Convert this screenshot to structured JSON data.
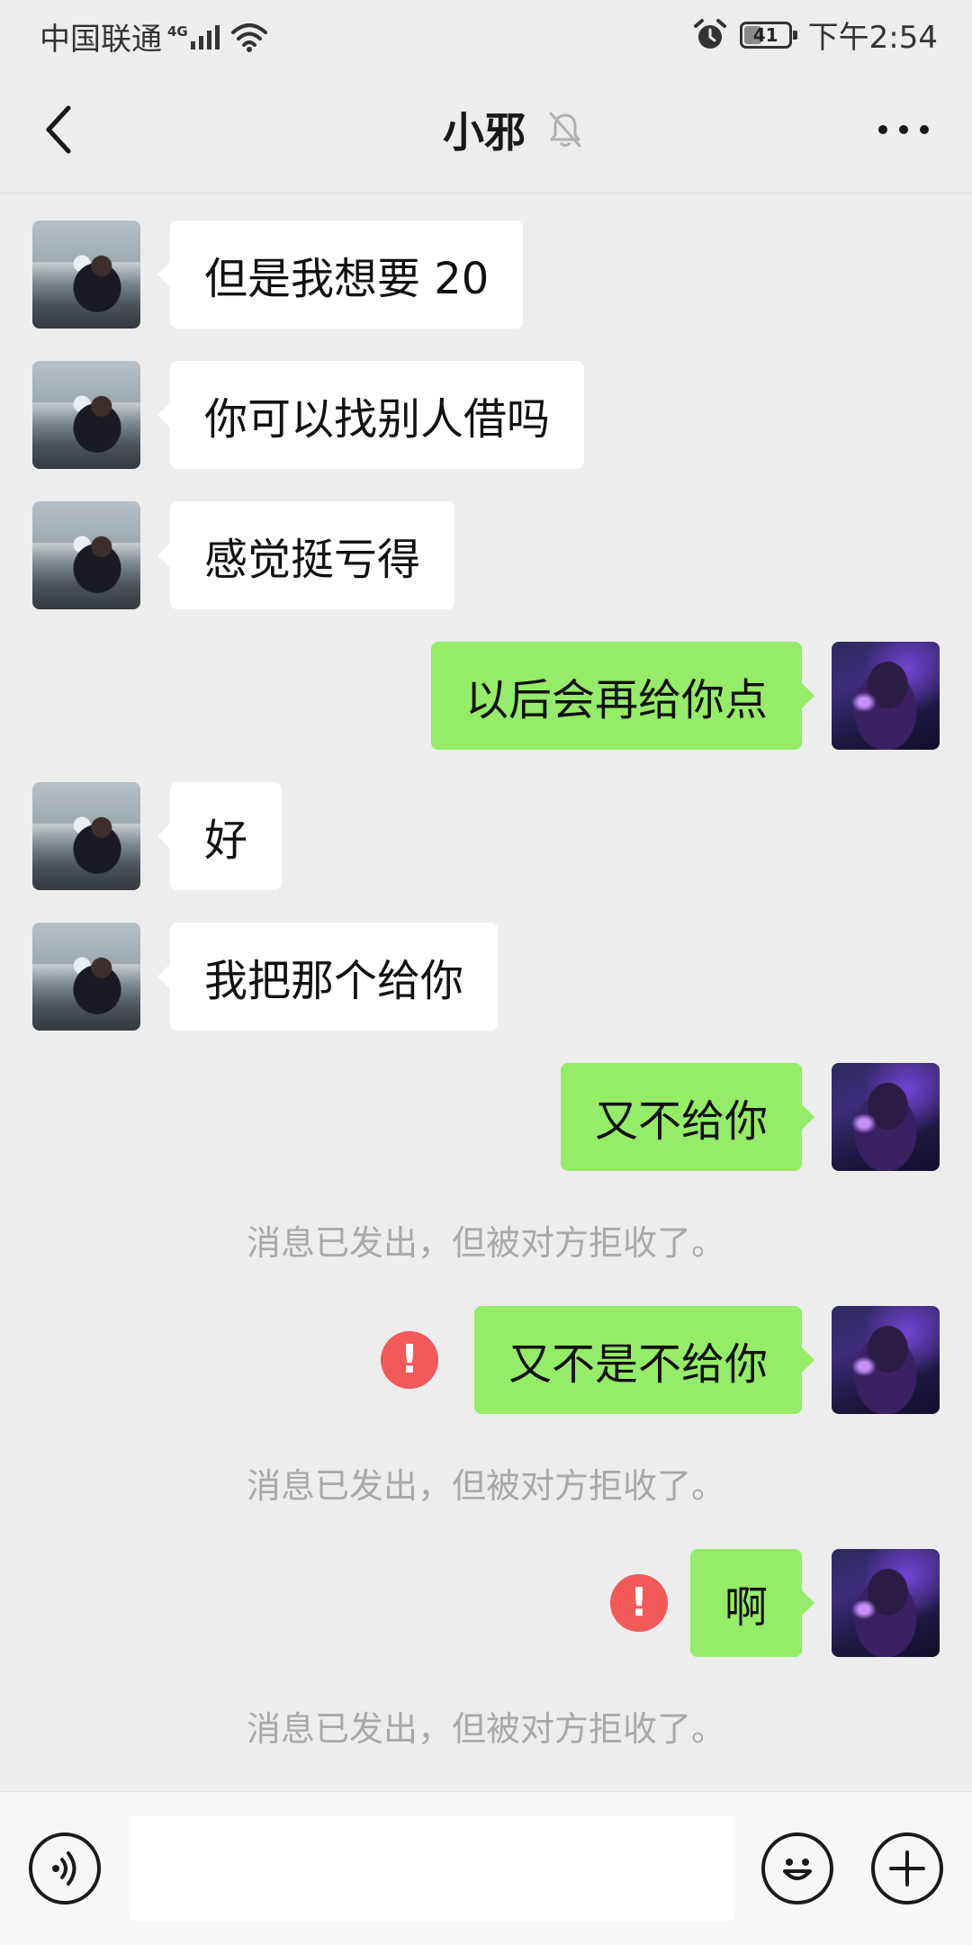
{
  "status_bar": {
    "carrier": "中国联通",
    "network_type": "4G",
    "battery_level": "41",
    "battery_percent": 41,
    "time": "下午2:54"
  },
  "title_bar": {
    "title": "小邪",
    "back_icon": "chevron-left-icon",
    "mute_icon": "bell-off-icon",
    "more_icon": "more-horizontal-icon"
  },
  "messages": [
    {
      "from": "friend",
      "text": "但是我想要 20"
    },
    {
      "from": "friend",
      "text": "你可以找别人借吗"
    },
    {
      "from": "friend",
      "text": "感觉挺亏得"
    },
    {
      "from": "me",
      "text": "以后会再给你点"
    },
    {
      "from": "friend",
      "text": "好"
    },
    {
      "from": "friend",
      "text": "我把那个给你"
    },
    {
      "from": "me",
      "text": "又不给你"
    },
    {
      "from": "me",
      "text": "又不是不给你",
      "failed": true,
      "error_mark": "!"
    },
    {
      "from": "me",
      "text": "啊",
      "failed": true,
      "error_mark": "!"
    }
  ],
  "system_notes": [
    "消息已发出，但被对方拒收了。",
    "消息已发出，但被对方拒收了。",
    "消息已发出，但被对方拒收了。"
  ],
  "input_bar": {
    "voice_icon": "voice-icon",
    "emoji_icon": "emoji-icon",
    "plus_icon": "plus-icon",
    "input_value": ""
  },
  "colors": {
    "background": "#ededed",
    "incoming_bubble": "#ffffff",
    "outgoing_bubble": "#95ec69",
    "error": "#f35959",
    "system_text": "#a8a8a8"
  }
}
